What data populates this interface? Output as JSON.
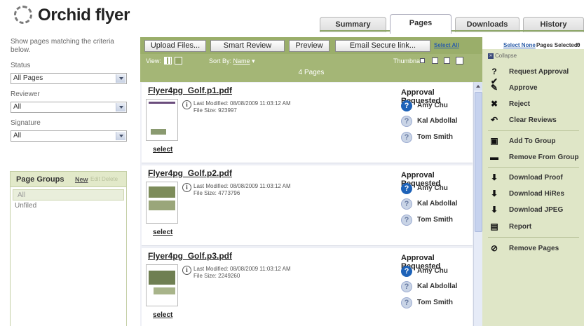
{
  "app": {
    "title": "Orchid flyer"
  },
  "tabs": [
    {
      "label": "Summary"
    },
    {
      "label": "Pages"
    },
    {
      "label": "Downloads"
    },
    {
      "label": "History"
    }
  ],
  "sidebar": {
    "criteria_text": "Show pages matching the criteria below.",
    "status_label": "Status",
    "status_value": "All Pages",
    "reviewer_label": "Reviewer",
    "reviewer_value": "All",
    "signature_label": "Signature",
    "signature_value": "All",
    "page_groups": {
      "title": "Page Groups",
      "new_label": "New",
      "edit_label": "Edit Delete",
      "items": [
        "All",
        "Unfiled"
      ]
    }
  },
  "toolbar": {
    "upload": "Upload Files...",
    "smart_review": "Smart Review",
    "preview": "Preview",
    "email": "Email Secure link...",
    "view_label": "View:",
    "sort_label": "Sort By:",
    "sort_value": "Name",
    "page_count": "4 Pages",
    "thumbnail_label": "Thumbnail:"
  },
  "selection": {
    "select_all": "Select All",
    "select_none": "Select None",
    "pages_selected_label": "Pages Selected:",
    "pages_selected_count": "0"
  },
  "pages": [
    {
      "name": "Flyer4pg_Golf.p1.pdf",
      "last_modified": "Last Modified: 08/08/2009 11:03:12 AM",
      "file_size": "File Size: 923997",
      "select_label": "select",
      "approval_title": "Approval Requested",
      "reviewers": [
        "Amy Chu",
        "Kal Abdollal",
        "Tom Smith"
      ]
    },
    {
      "name": "Flyer4pg_Golf.p2.pdf",
      "last_modified": "Last Modified: 08/08/2009 11:03:12 AM",
      "file_size": "File Size: 4773796",
      "select_label": "select",
      "approval_title": "Approval Requested",
      "reviewers": [
        "Amy Chu",
        "Kal Abdollal",
        "Tom Smith"
      ]
    },
    {
      "name": "Flyer4pg_Golf.p3.pdf",
      "last_modified": "Last Modified: 08/08/2009 11:03:12 AM",
      "file_size": "File Size: 2249260",
      "select_label": "select",
      "approval_title": "Approval Requested",
      "reviewers": [
        "Amy Chu",
        "Kal Abdollal",
        "Tom Smith"
      ]
    }
  ],
  "actions": {
    "collapse": "Collapse",
    "request_approval": "Request Approval",
    "approve": "Approve",
    "reject": "Reject",
    "clear_reviews": "Clear Reviews",
    "add_to_group": "Add To Group",
    "remove_from_group": "Remove From Group",
    "download_proof": "Download Proof",
    "download_hires": "Download HiRes",
    "download_jpeg": "Download JPEG",
    "report": "Report",
    "remove_pages": "Remove Pages"
  },
  "colors": {
    "accent_green": "#9aae6a",
    "panel_green": "#dfe6c7",
    "reviewer_blue": "#1d62b8"
  }
}
